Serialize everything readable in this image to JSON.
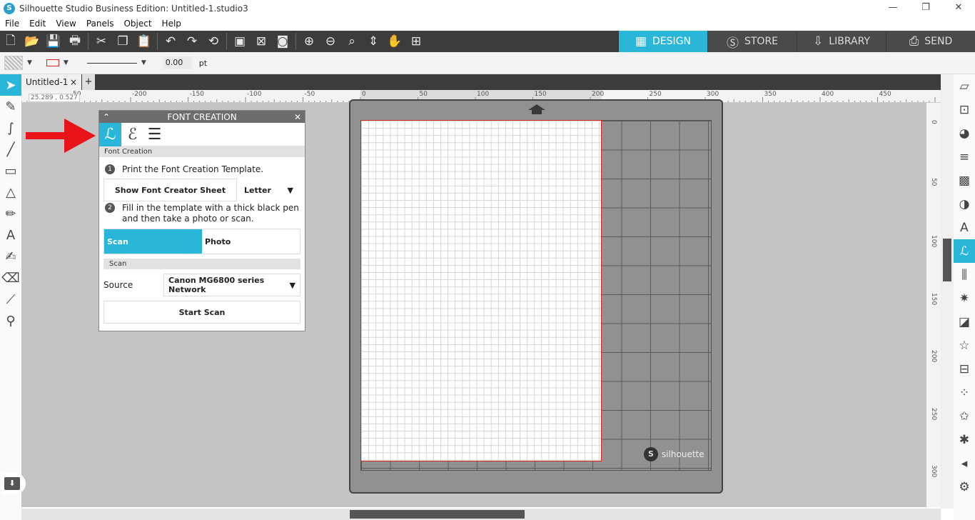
{
  "window": {
    "title": "Silhouette Studio Business Edition: Untitled-1.studio3",
    "icon": "S",
    "controls": [
      "—",
      "❐",
      "✕"
    ]
  },
  "menu": [
    "File",
    "Edit",
    "View",
    "Panels",
    "Object",
    "Help"
  ],
  "toolbar": {
    "icons": [
      "new-icon",
      "open-icon",
      "save-icon",
      "print-icon",
      "cut-icon",
      "copy-icon",
      "paste-icon",
      "undo-icon",
      "redo-icon",
      "rotate-icon",
      "group-icon",
      "ungroup-icon",
      "compound-icon",
      "zoom-in-icon",
      "zoom-out-icon",
      "zoom-select-icon",
      "move-icon",
      "pan-icon",
      "fit-icon"
    ],
    "tabs": [
      {
        "label": "DESIGN",
        "icon": "grid-icon",
        "active": true
      },
      {
        "label": "STORE",
        "icon": "silhouette-logo-icon",
        "active": false
      },
      {
        "label": "LIBRARY",
        "icon": "library-icon",
        "active": false
      },
      {
        "label": "SEND",
        "icon": "send-icon",
        "active": false
      }
    ]
  },
  "properties": {
    "line_width": "0.00",
    "unit": "pt"
  },
  "document": {
    "tab_name": "Untitled-1",
    "close": "×",
    "add": "+"
  },
  "ruler": {
    "coordinate": "25.289 , 0.527",
    "top_labels": [
      "50",
      "-200",
      "-150",
      "-100",
      "-50",
      "0",
      "50",
      "100",
      "150",
      "200",
      "250",
      "300",
      "350",
      "400",
      "450"
    ],
    "left_labels": [
      "0",
      "50",
      "100",
      "150",
      "200",
      "250",
      "300"
    ]
  },
  "mat": {
    "brand": "silhouette",
    "marks": [
      "1",
      "10",
      "11",
      "12",
      "12"
    ]
  },
  "panel": {
    "title": "FONT CREATION",
    "section": "Font Creation",
    "step1_num": "1",
    "step1": "Print the Font Creation Template.",
    "show_sheet_button": "Show Font Creator Sheet",
    "paper_size": "Letter",
    "step2_num": "2",
    "step2": "Fill in the template with a thick black pen and then take a photo or scan.",
    "scan_option": "Scan",
    "photo_option": "Photo",
    "scan_section": "Scan",
    "source_label": "Source",
    "source_value": "Canon MG6800 series Network",
    "start_scan_button": "Start Scan"
  },
  "colors": {
    "accent": "#29b6d8",
    "toolbar": "#3c3c3c",
    "arrow": "#e8141a"
  }
}
